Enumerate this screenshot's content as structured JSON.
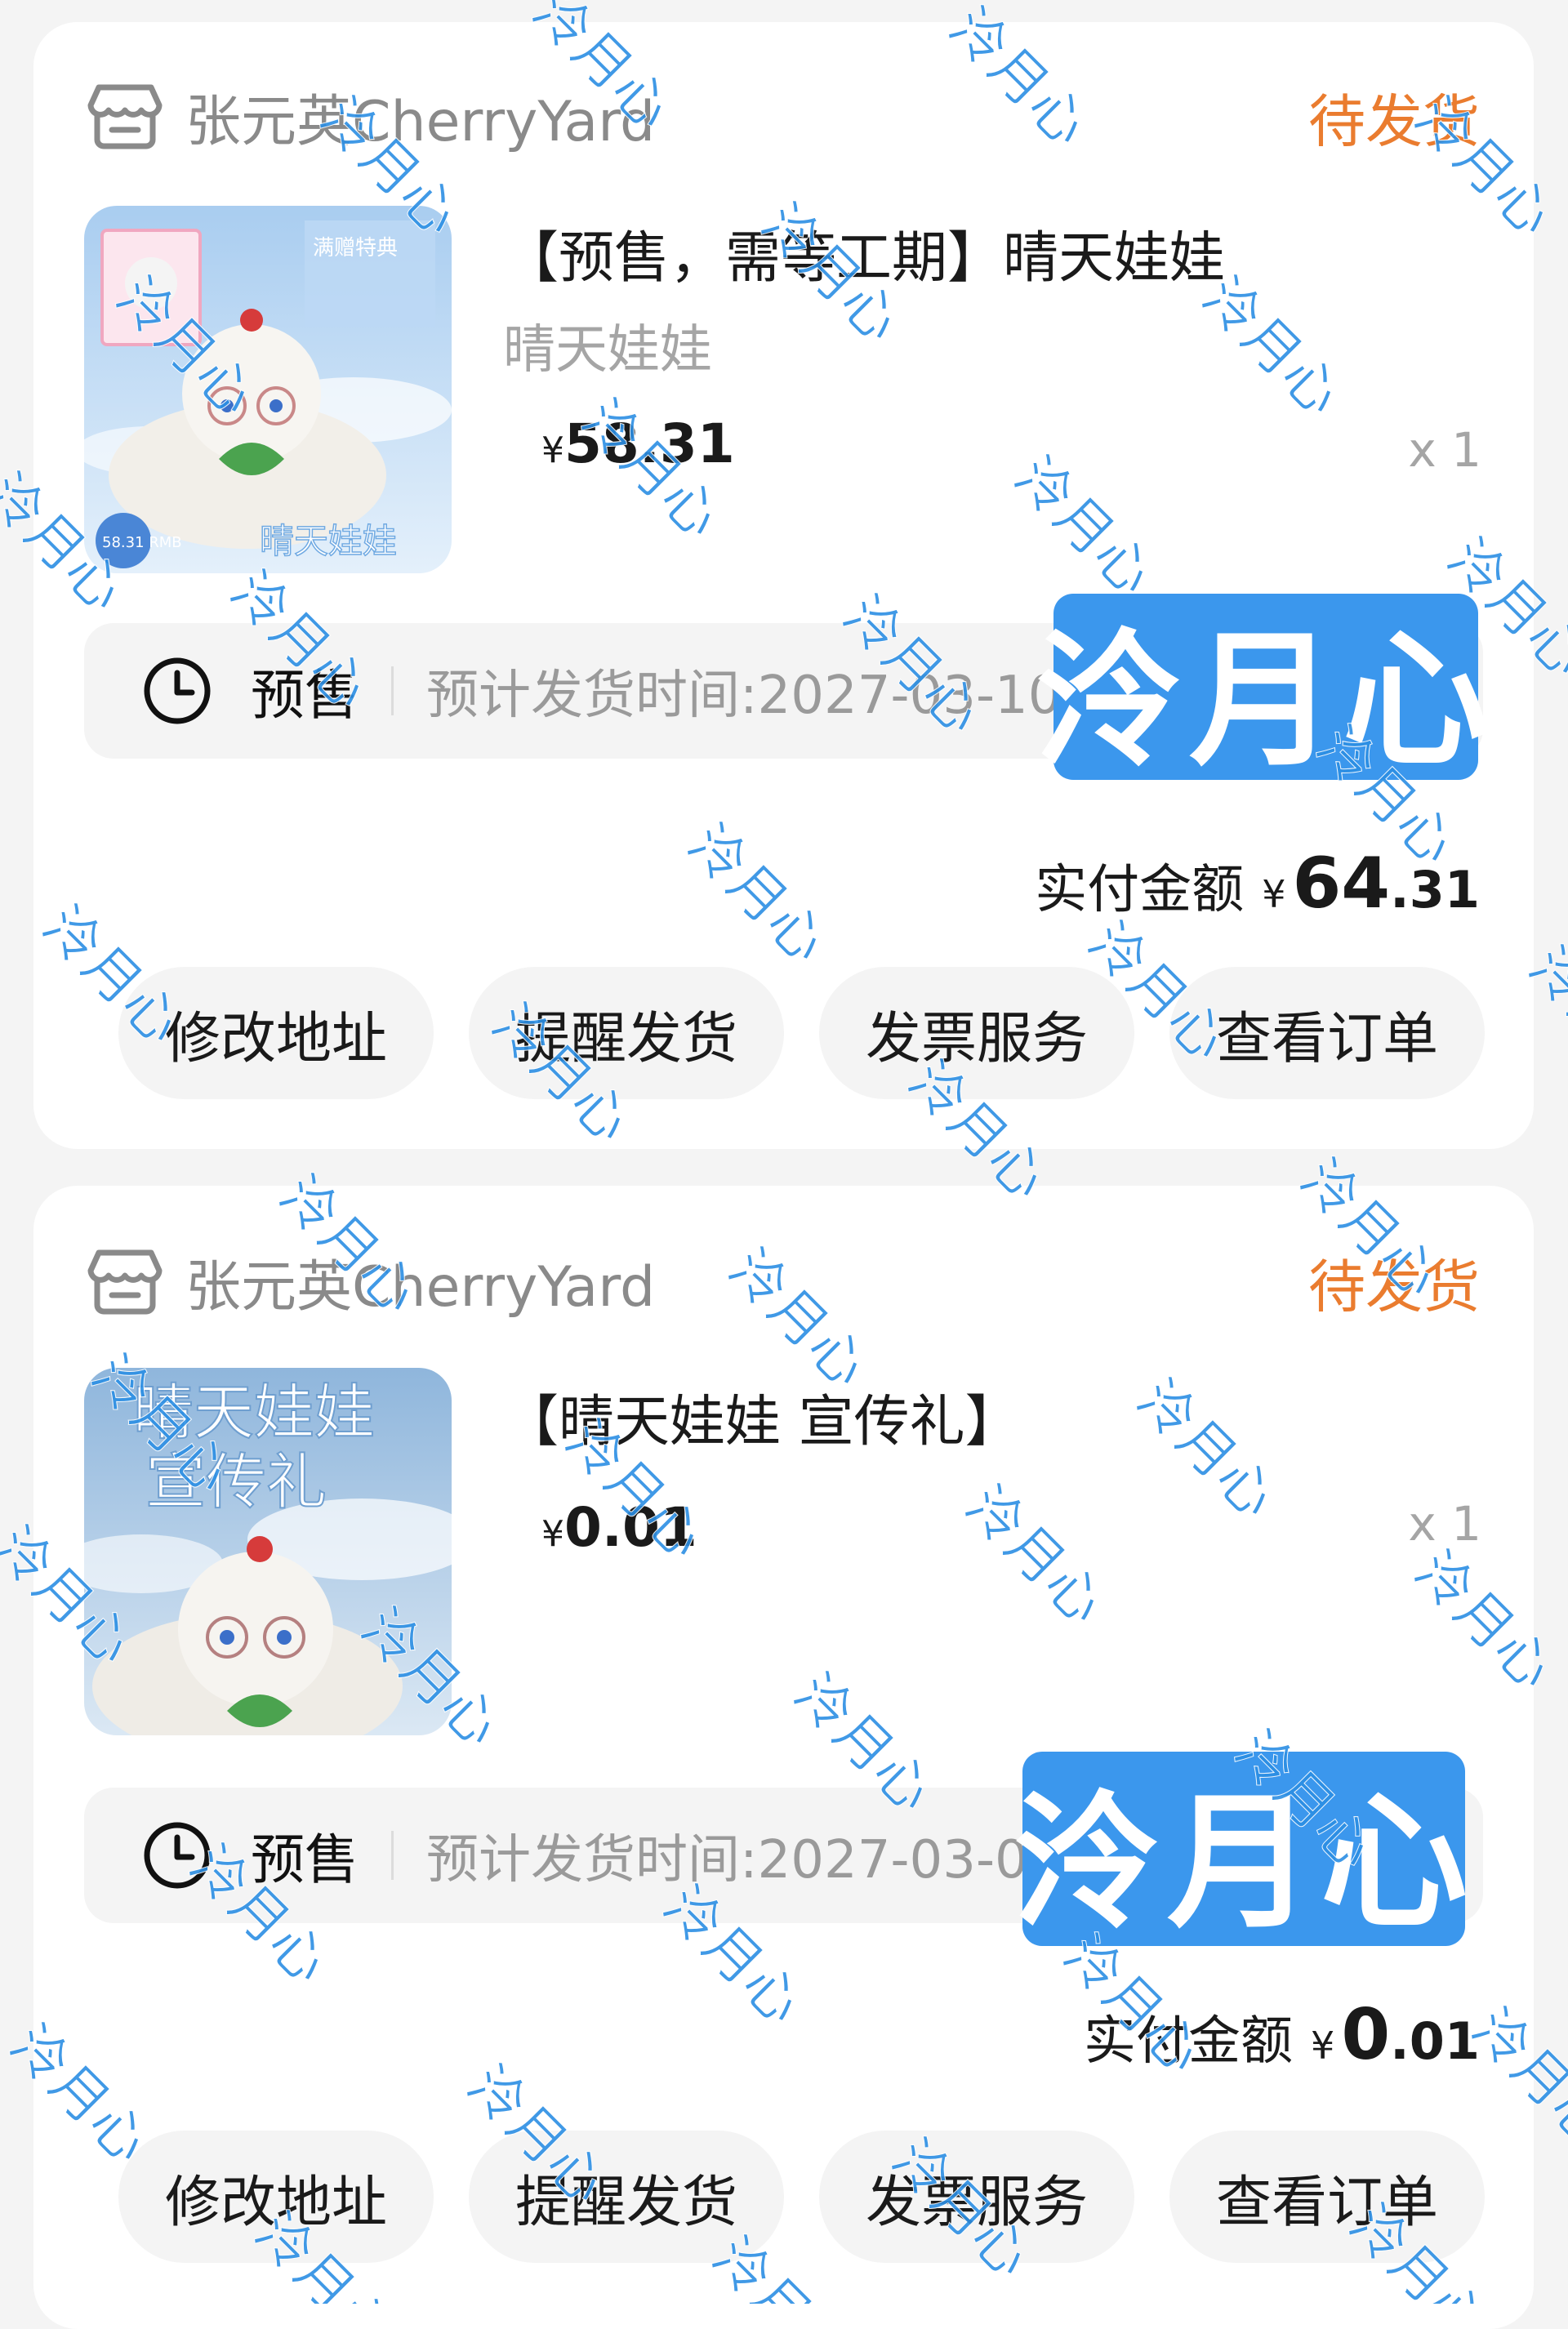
{
  "orders": [
    {
      "shop_name": "张元英CherryYard",
      "status": "待发货",
      "product_title": "【预售，需等工期】晴天娃娃",
      "sku": "晴天娃娃",
      "price_symbol": "¥",
      "price": "58.31",
      "quantity": "x 1",
      "presale_tag": "预售",
      "ship_time": "预计发货时间:2027-03-10",
      "paid_label": "实付金额",
      "paid_symbol": "¥",
      "paid_int": "64",
      "paid_dec": ".31",
      "thumb_texts": {
        "badge": "满赠特典",
        "bottom": "晴天娃娃",
        "price_tag": "58.31 RMB"
      },
      "buttons": [
        "修改地址",
        "提醒发货",
        "发票服务",
        "查看订单"
      ]
    },
    {
      "shop_name": "张元英CherryYard",
      "status": "待发货",
      "product_title": "【晴天娃娃 宣传礼】",
      "price_symbol": "¥",
      "price": "0.01",
      "quantity": "x 1",
      "presale_tag": "预售",
      "ship_time": "预计发货时间:2027-03-0",
      "paid_label": "实付金额",
      "paid_symbol": "¥",
      "paid_int": "0",
      "paid_dec": ".01",
      "thumb_texts": {
        "line1": "晴天娃娃",
        "line2": "宣传礼"
      },
      "buttons": [
        "修改地址",
        "提醒发货",
        "发票服务",
        "查看订单"
      ]
    }
  ],
  "overlay_label": "泠月心",
  "watermark_text": "泠月心",
  "colors": {
    "status": "#ea7c2f",
    "overlay": "#3b97ed",
    "watermark": "#2c8fe4"
  },
  "icons": [
    "shop-icon",
    "clock-icon"
  ]
}
